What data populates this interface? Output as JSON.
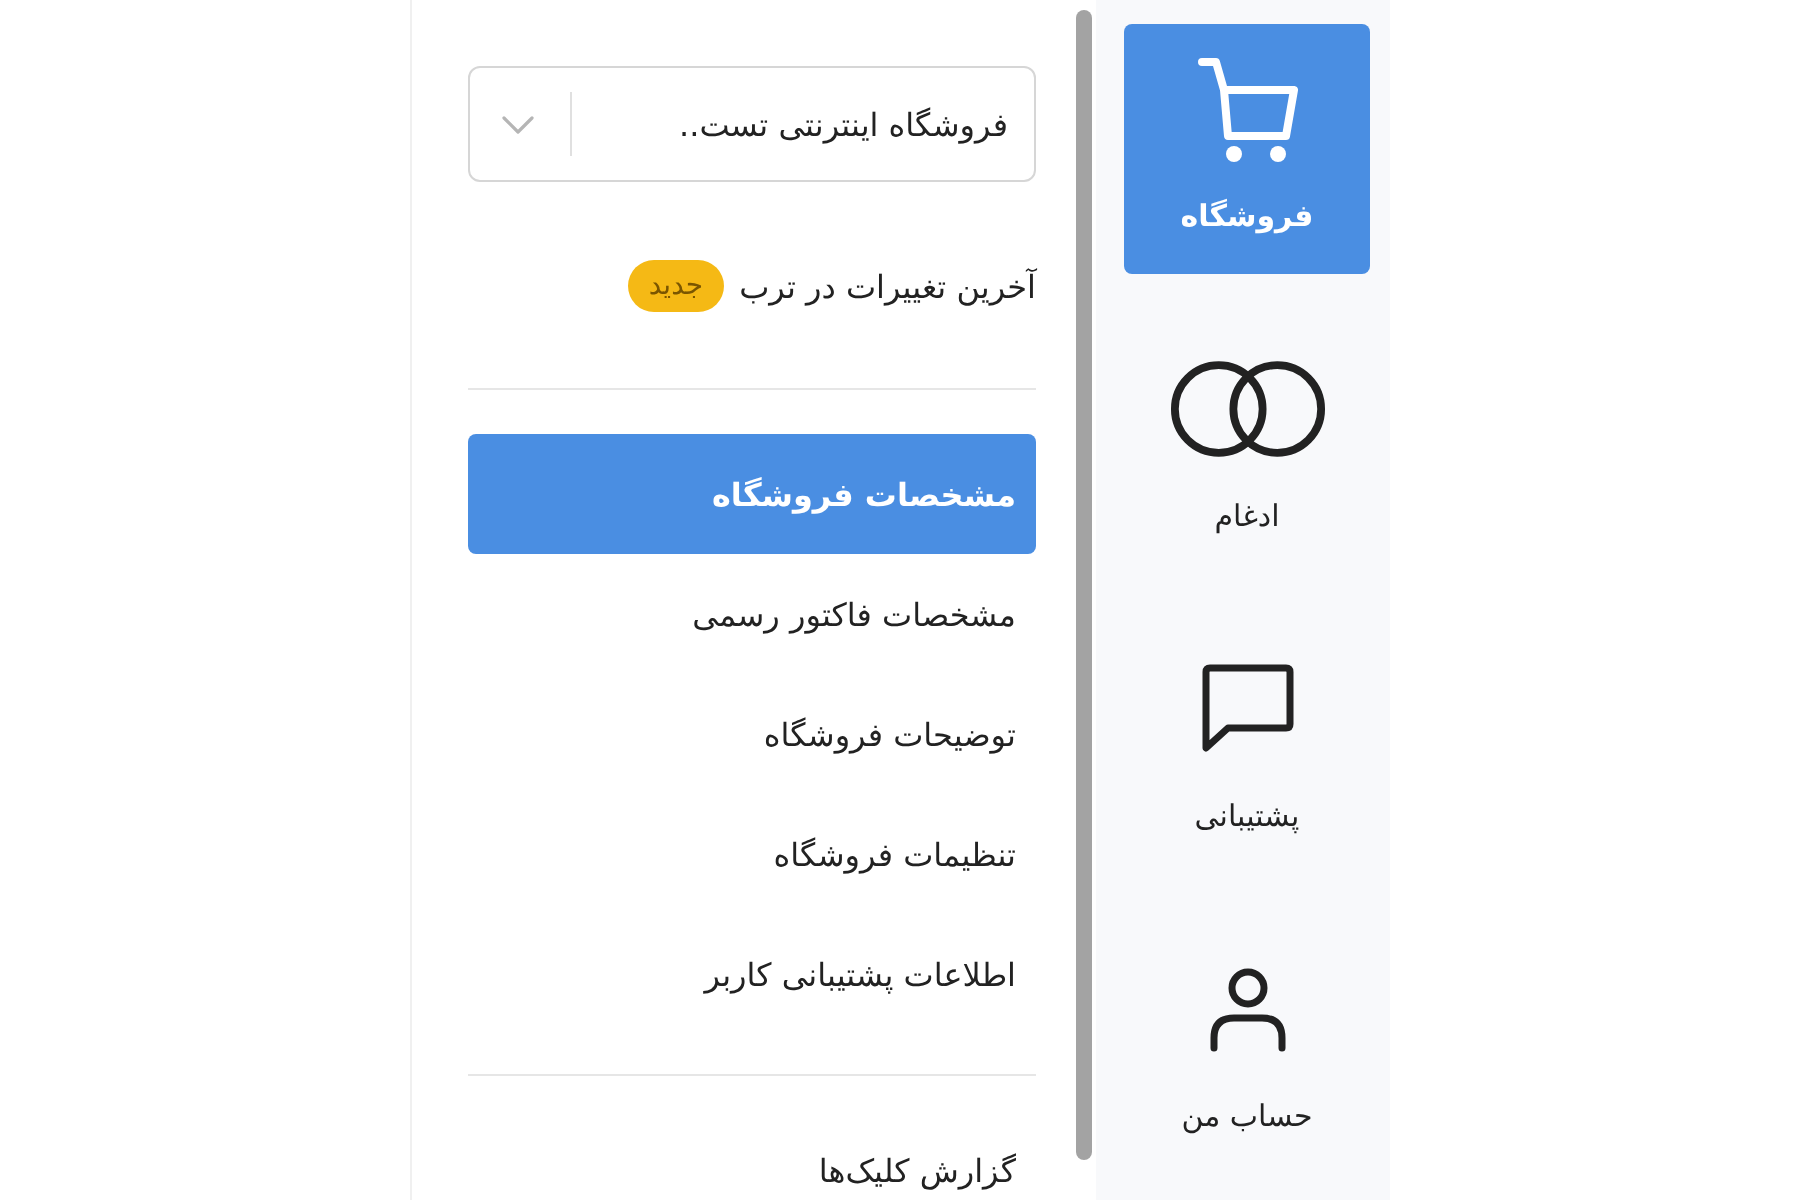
{
  "store_selector": {
    "value": "فروشگاه اینترنتی تست.."
  },
  "changelog": {
    "label": "آخرین تغییرات در ترب",
    "badge": "جدید"
  },
  "menu": {
    "items": [
      {
        "label": "مشخصات فروشگاه",
        "selected": true
      },
      {
        "label": "مشخصات فاکتور رسمی",
        "selected": false
      },
      {
        "label": "توضیحات فروشگاه",
        "selected": false
      },
      {
        "label": "تنظیمات فروشگاه",
        "selected": false
      },
      {
        "label": "اطلاعات پشتیبانی کاربر",
        "selected": false
      }
    ]
  },
  "reports": {
    "items": [
      {
        "label": "گزارش کلیک‌ها",
        "selected": false
      }
    ]
  },
  "rail": {
    "items": [
      {
        "kind": "cart",
        "label": "فروشگاه",
        "selected": true
      },
      {
        "kind": "rings",
        "label": "ادغام",
        "selected": false
      },
      {
        "kind": "chat",
        "label": "پشتیبانی",
        "selected": false
      },
      {
        "kind": "person",
        "label": "حساب من",
        "selected": false
      }
    ]
  }
}
